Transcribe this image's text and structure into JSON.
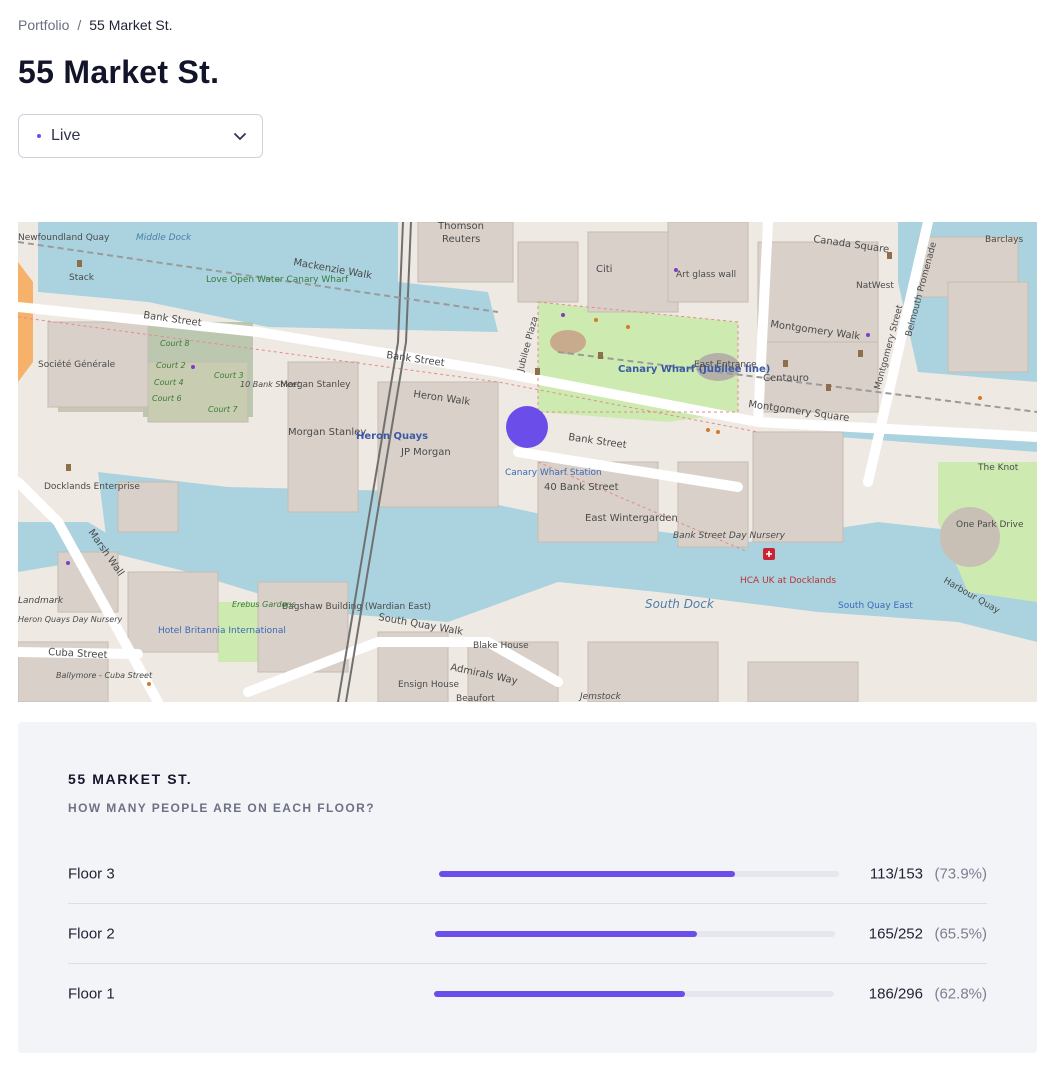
{
  "breadcrumb": {
    "root": "Portfolio",
    "separator": "/",
    "current": "55 Market St."
  },
  "page": {
    "title": "55 Market St."
  },
  "mode_select": {
    "value": "Live",
    "icon": "chevron-down-icon"
  },
  "map": {
    "labels": {
      "canary_square": "Canada Square",
      "barclays": "Barclays",
      "thomson": "Thomson",
      "reuters": "Reuters",
      "citi": "Citi",
      "mackenzie": "Mackenzie Walk",
      "bank_street_w": "Bank Street",
      "bank_street_mid": "Bank Street",
      "bank_street_e": "Bank Street",
      "heron_walk": "Heron Walk",
      "morgan_stanley1": "Morgan Stanley",
      "morgan_stanley2": "Morgan Stanley",
      "jp_morgan": "JP Morgan",
      "heron_quays": "Heron Quays",
      "canary_wharf_station": "Canary Wharf Station",
      "canary_wharf_jubilee": "Canary Wharf (Jubilee line)",
      "east_entrance": "East Entrance",
      "montgomery_walk": "Montgomery Walk",
      "montgomery_sq": "Montgomery Square",
      "centauro": "Centauro",
      "natwest": "NatWest",
      "forty_bank": "40 Bank Street",
      "east_wintergarden": "East Wintergarden",
      "bank_street_day": "Bank Street Day Nursery",
      "hca": "HCA UK at Docklands",
      "south_dock": "South Dock",
      "south_quay_walk": "South Quay Walk",
      "south_quay_east": "South Quay East",
      "blake_house": "Blake House",
      "admirals_way": "Admirals Way",
      "ensign_house": "Ensign House",
      "beaufort": "Beaufort",
      "jemstock": "Jemstock",
      "cuba_street": "Cuba Street",
      "ballymore": "Ballymore - Cuba Street",
      "hotel_britannia": "Hotel Britannia International",
      "bagshaw": "Bagshaw Building (Wardian East)",
      "erebus": "Erebus Gardens",
      "docklands_ent": "Docklands Enterprise",
      "societe": "Société Générale",
      "love_open": "Love Open Water Canary Wharf",
      "stack": "Stack",
      "marsh_wall": "Marsh Wall",
      "harbour_quay": "Harbour Quay",
      "the_knot": "The Knot",
      "one_park": "One Park Drive",
      "art_glass": "Art glass wall",
      "jubilee_plaza": "Jubilee Plaza",
      "belmouth": "Belmouth Promenade",
      "montgomery_st": "Montgomery Street",
      "court8": "Court 8",
      "court2": "Court 2",
      "court4": "Court 4",
      "court6": "Court 6",
      "court3": "Court 3",
      "court7": "Court 7",
      "ten_bank": "10 Bank Street",
      "landmark": "Landmark",
      "heron_quays_nursery": "Heron Quays Day Nursery",
      "middle_dock": "Middle Dock",
      "newfoundland": "Newfoundland Quay"
    }
  },
  "occupancy": {
    "title": "55 MARKET ST.",
    "subtitle": "HOW MANY PEOPLE ARE ON EACH FLOOR?",
    "accent_color": "#6b4eea",
    "floors": [
      {
        "name": "Floor 3",
        "count": "113/153",
        "pct": "(73.9%)",
        "fraction": 0.739
      },
      {
        "name": "Floor 2",
        "count": "165/252",
        "pct": "(65.5%)",
        "fraction": 0.655
      },
      {
        "name": "Floor 1",
        "count": "186/296",
        "pct": "(62.8%)",
        "fraction": 0.628
      }
    ]
  }
}
